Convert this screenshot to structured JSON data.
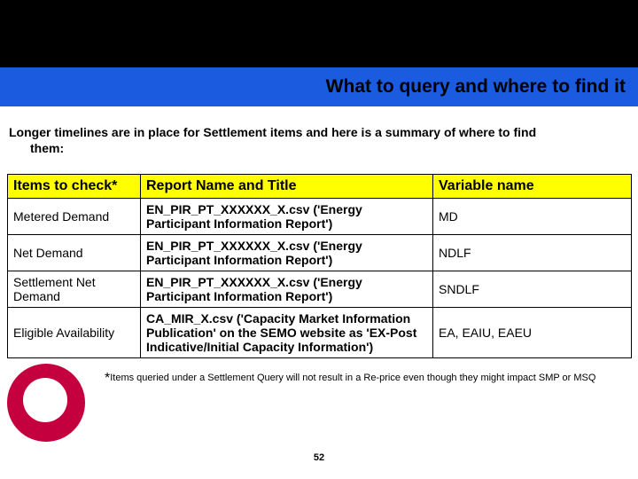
{
  "header": {
    "title": "What to query and where to find it"
  },
  "intro": {
    "line1": "Longer timelines are in place for Settlement items and here is a summary of where to find",
    "line2": "them:"
  },
  "table": {
    "headers": {
      "col1": "Items to check*",
      "col2": "Report Name and Title",
      "col3": "Variable name"
    },
    "rows": [
      {
        "item": "Metered Demand",
        "report": "EN_PIR_PT_XXXXXX_X.csv ('Energy Participant Information Report')",
        "variable": "MD"
      },
      {
        "item": "Net Demand",
        "report": "EN_PIR_PT_XXXXXX_X.csv ('Energy Participant Information Report')",
        "variable": "NDLF"
      },
      {
        "item": "Settlement Net Demand",
        "report": "EN_PIR_PT_XXXXXX_X.csv ('Energy Participant Information Report')",
        "variable": "SNDLF"
      },
      {
        "item": "Eligible Availability",
        "report": "CA_MIR_X.csv ('Capacity Market Information Publication' on the SEMO website as 'EX-Post Indicative/Initial Capacity Information')",
        "variable": "EA, EAIU, EAEU"
      }
    ]
  },
  "footnote": {
    "text": "Items queried under a Settlement Query will not result in a Re-price even though they might impact SMP or MSQ"
  },
  "page_number": "52"
}
